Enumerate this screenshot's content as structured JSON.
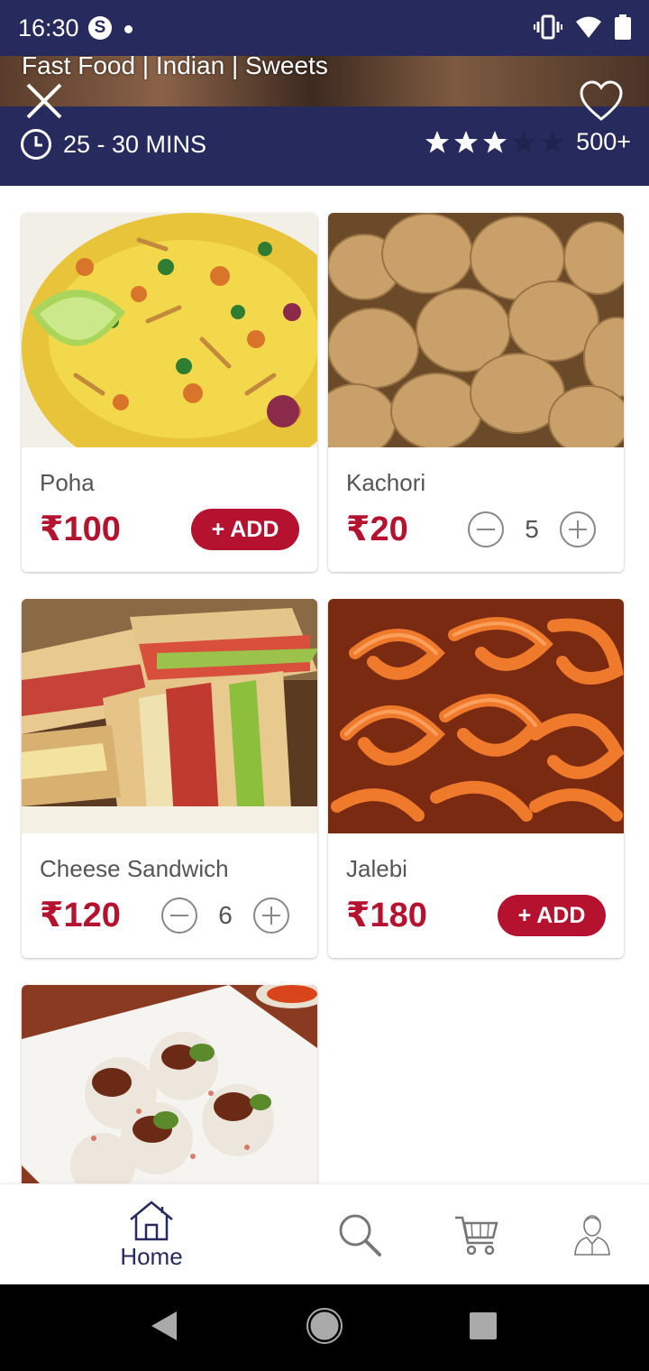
{
  "status_bar": {
    "time": "16:30",
    "skype_glyph": "S"
  },
  "header": {
    "cuisines": "Fast Food | Indian | Sweets",
    "delivery_time": "25 - 30 MINS",
    "rating": 3,
    "rating_max": 5,
    "reviews": "500+",
    "colors": {
      "header_bg": "#262a5c",
      "accent": "#b4122e"
    }
  },
  "items": [
    {
      "name": "Poha",
      "price": "₹100",
      "action": "add",
      "add_label": "+ ADD"
    },
    {
      "name": "Kachori",
      "price": "₹20",
      "action": "stepper",
      "qty": "5"
    },
    {
      "name": "Cheese Sandwich",
      "price": "₹120",
      "action": "stepper",
      "qty": "6"
    },
    {
      "name": "Jalebi",
      "price": "₹180",
      "action": "add",
      "add_label": "+ ADD"
    },
    {
      "name": "",
      "price": "",
      "action": "none"
    }
  ],
  "bottom_nav": {
    "items": [
      {
        "label": "Home",
        "icon": "home-icon",
        "active": true
      },
      {
        "label": "",
        "icon": "search-icon"
      },
      {
        "label": "",
        "icon": "cart-icon"
      },
      {
        "label": "",
        "icon": "profile-icon"
      }
    ]
  }
}
